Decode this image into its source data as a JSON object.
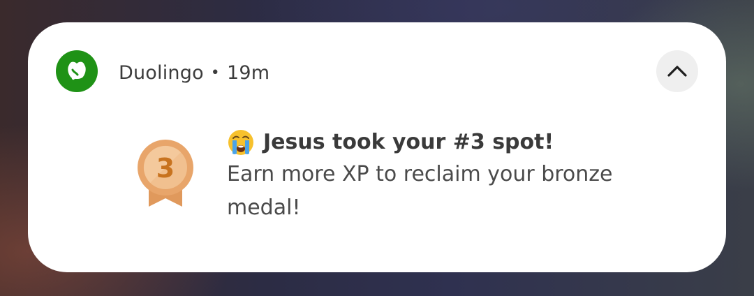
{
  "notification": {
    "app_name": "Duolingo",
    "separator": "•",
    "time": "19m",
    "app_icon": "duolingo-owl-icon",
    "collapse_icon": "chevron-up-icon",
    "medal_icon": "bronze-medal-icon",
    "medal_number": "3",
    "title_emoji_icon": "crying-face-emoji-icon",
    "title": "Jesus took your #3 spot!",
    "body": "Earn more XP to reclaim your bronze medal!",
    "colors": {
      "brand_green": "#1f9216",
      "medal_orange": "#e39a5c",
      "medal_number": "#c8731f"
    }
  }
}
